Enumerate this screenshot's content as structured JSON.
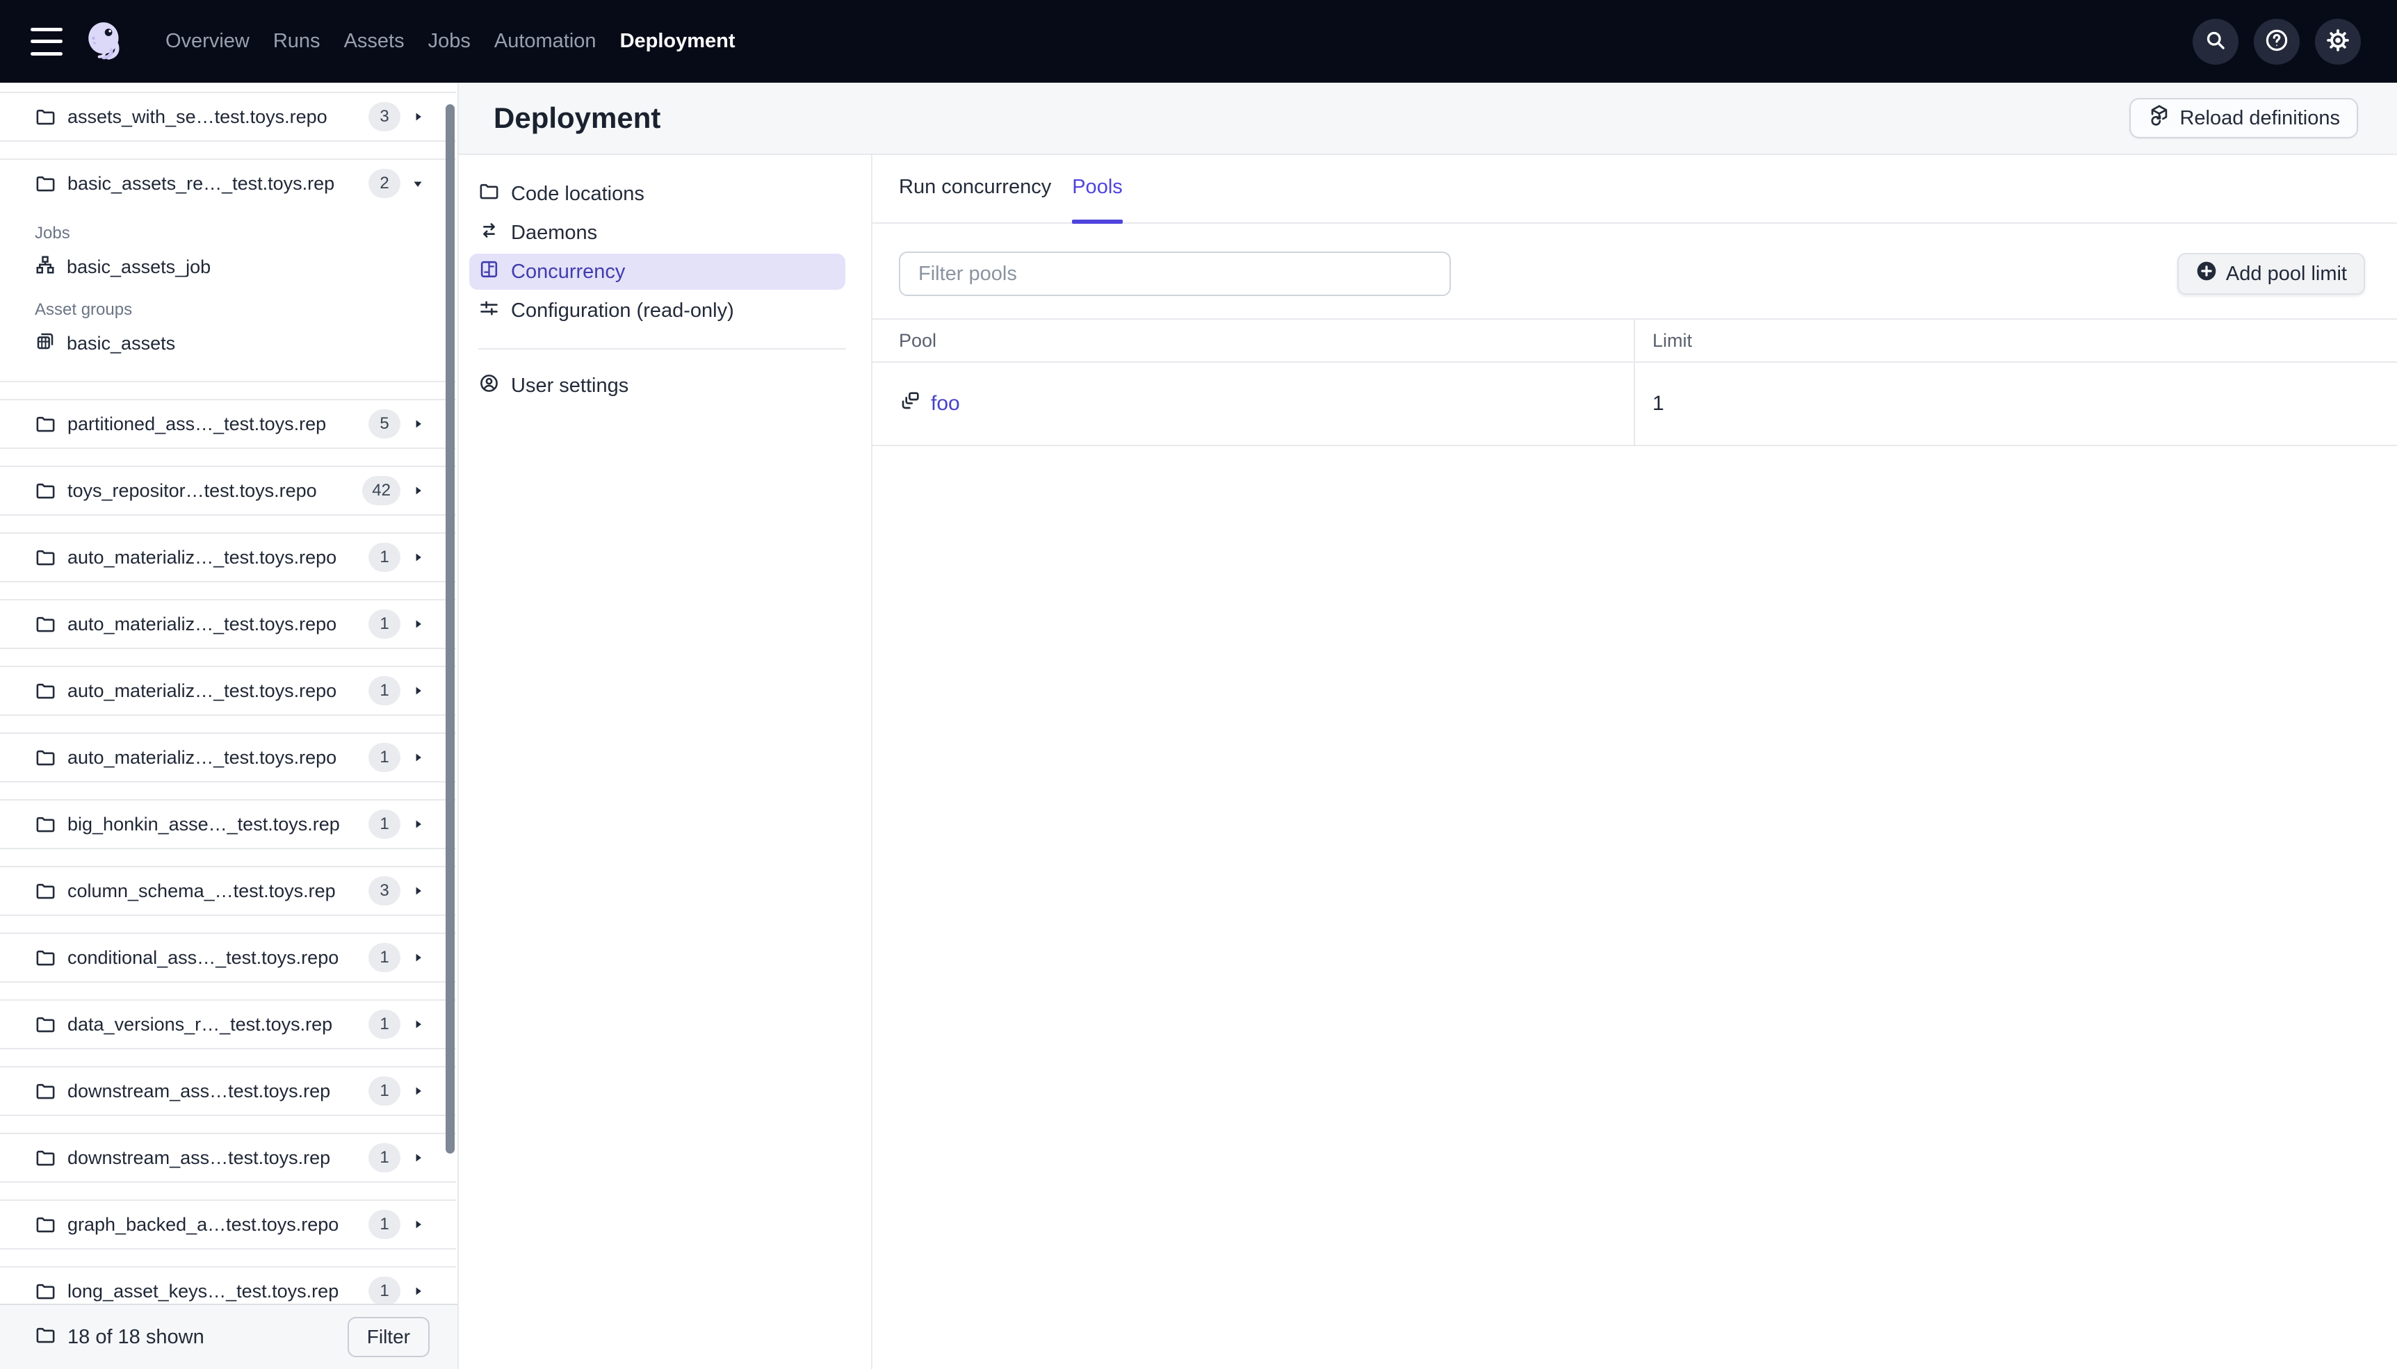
{
  "navbar": {
    "items": [
      {
        "label": "Overview"
      },
      {
        "label": "Runs"
      },
      {
        "label": "Assets"
      },
      {
        "label": "Jobs"
      },
      {
        "label": "Automation"
      },
      {
        "label": "Deployment"
      }
    ],
    "active": "Deployment"
  },
  "sidebar": {
    "items": [
      {
        "name": "assets_with_se…test.toys.repo",
        "badge": "3"
      },
      {
        "name": "basic_assets_re…_test.toys.rep",
        "badge": "2"
      },
      {
        "name": "partitioned_ass…_test.toys.rep",
        "badge": "5"
      },
      {
        "name": "toys_repositor…test.toys.repo",
        "badge": "42"
      },
      {
        "name": "auto_materializ…_test.toys.repo",
        "badge": "1"
      },
      {
        "name": "auto_materializ…_test.toys.repo",
        "badge": "1"
      },
      {
        "name": "auto_materializ…_test.toys.repo",
        "badge": "1"
      },
      {
        "name": "auto_materializ…_test.toys.repo",
        "badge": "1"
      },
      {
        "name": "big_honkin_asse…_test.toys.rep",
        "badge": "1"
      },
      {
        "name": "column_schema_…test.toys.rep",
        "badge": "3"
      },
      {
        "name": "conditional_ass…_test.toys.repo",
        "badge": "1"
      },
      {
        "name": "data_versions_r…_test.toys.rep",
        "badge": "1"
      },
      {
        "name": "downstream_ass…test.toys.rep",
        "badge": "1"
      },
      {
        "name": "downstream_ass…test.toys.rep",
        "badge": "1"
      },
      {
        "name": "graph_backed_a…test.toys.repo",
        "badge": "1"
      },
      {
        "name": "long_asset_keys…_test.toys.rep",
        "badge": "1"
      }
    ],
    "expanded": {
      "jobs_label": "Jobs",
      "job": "basic_assets_job",
      "asset_groups_label": "Asset groups",
      "asset_group": "basic_assets"
    },
    "footer": {
      "summary": "18 of 18 shown",
      "filter_label": "Filter"
    }
  },
  "header": {
    "title": "Deployment",
    "reload_label": "Reload definitions"
  },
  "subnav": {
    "items": [
      {
        "label": "Code locations"
      },
      {
        "label": "Daemons"
      },
      {
        "label": "Concurrency"
      },
      {
        "label": "Configuration (read-only)"
      },
      {
        "label": "User settings"
      }
    ],
    "active": "Concurrency"
  },
  "tabs": [
    {
      "label": "Run concurrency"
    },
    {
      "label": "Pools"
    }
  ],
  "active_tab": "Pools",
  "pools": {
    "filter_placeholder": "Filter pools",
    "add_button": "Add pool limit",
    "table": {
      "columns": [
        "Pool",
        "Limit"
      ],
      "rows": [
        {
          "pool": "foo",
          "limit": "1"
        }
      ]
    }
  },
  "colors": {
    "navbar_bg": "#070B18",
    "header_bg": "#F6F7F8",
    "accent": "#4F43DD",
    "selected_pill_bg": "#E4E2F9",
    "link": "#4642C9",
    "border": "#E7E9EC",
    "badge_bg": "#E9EBEF"
  }
}
